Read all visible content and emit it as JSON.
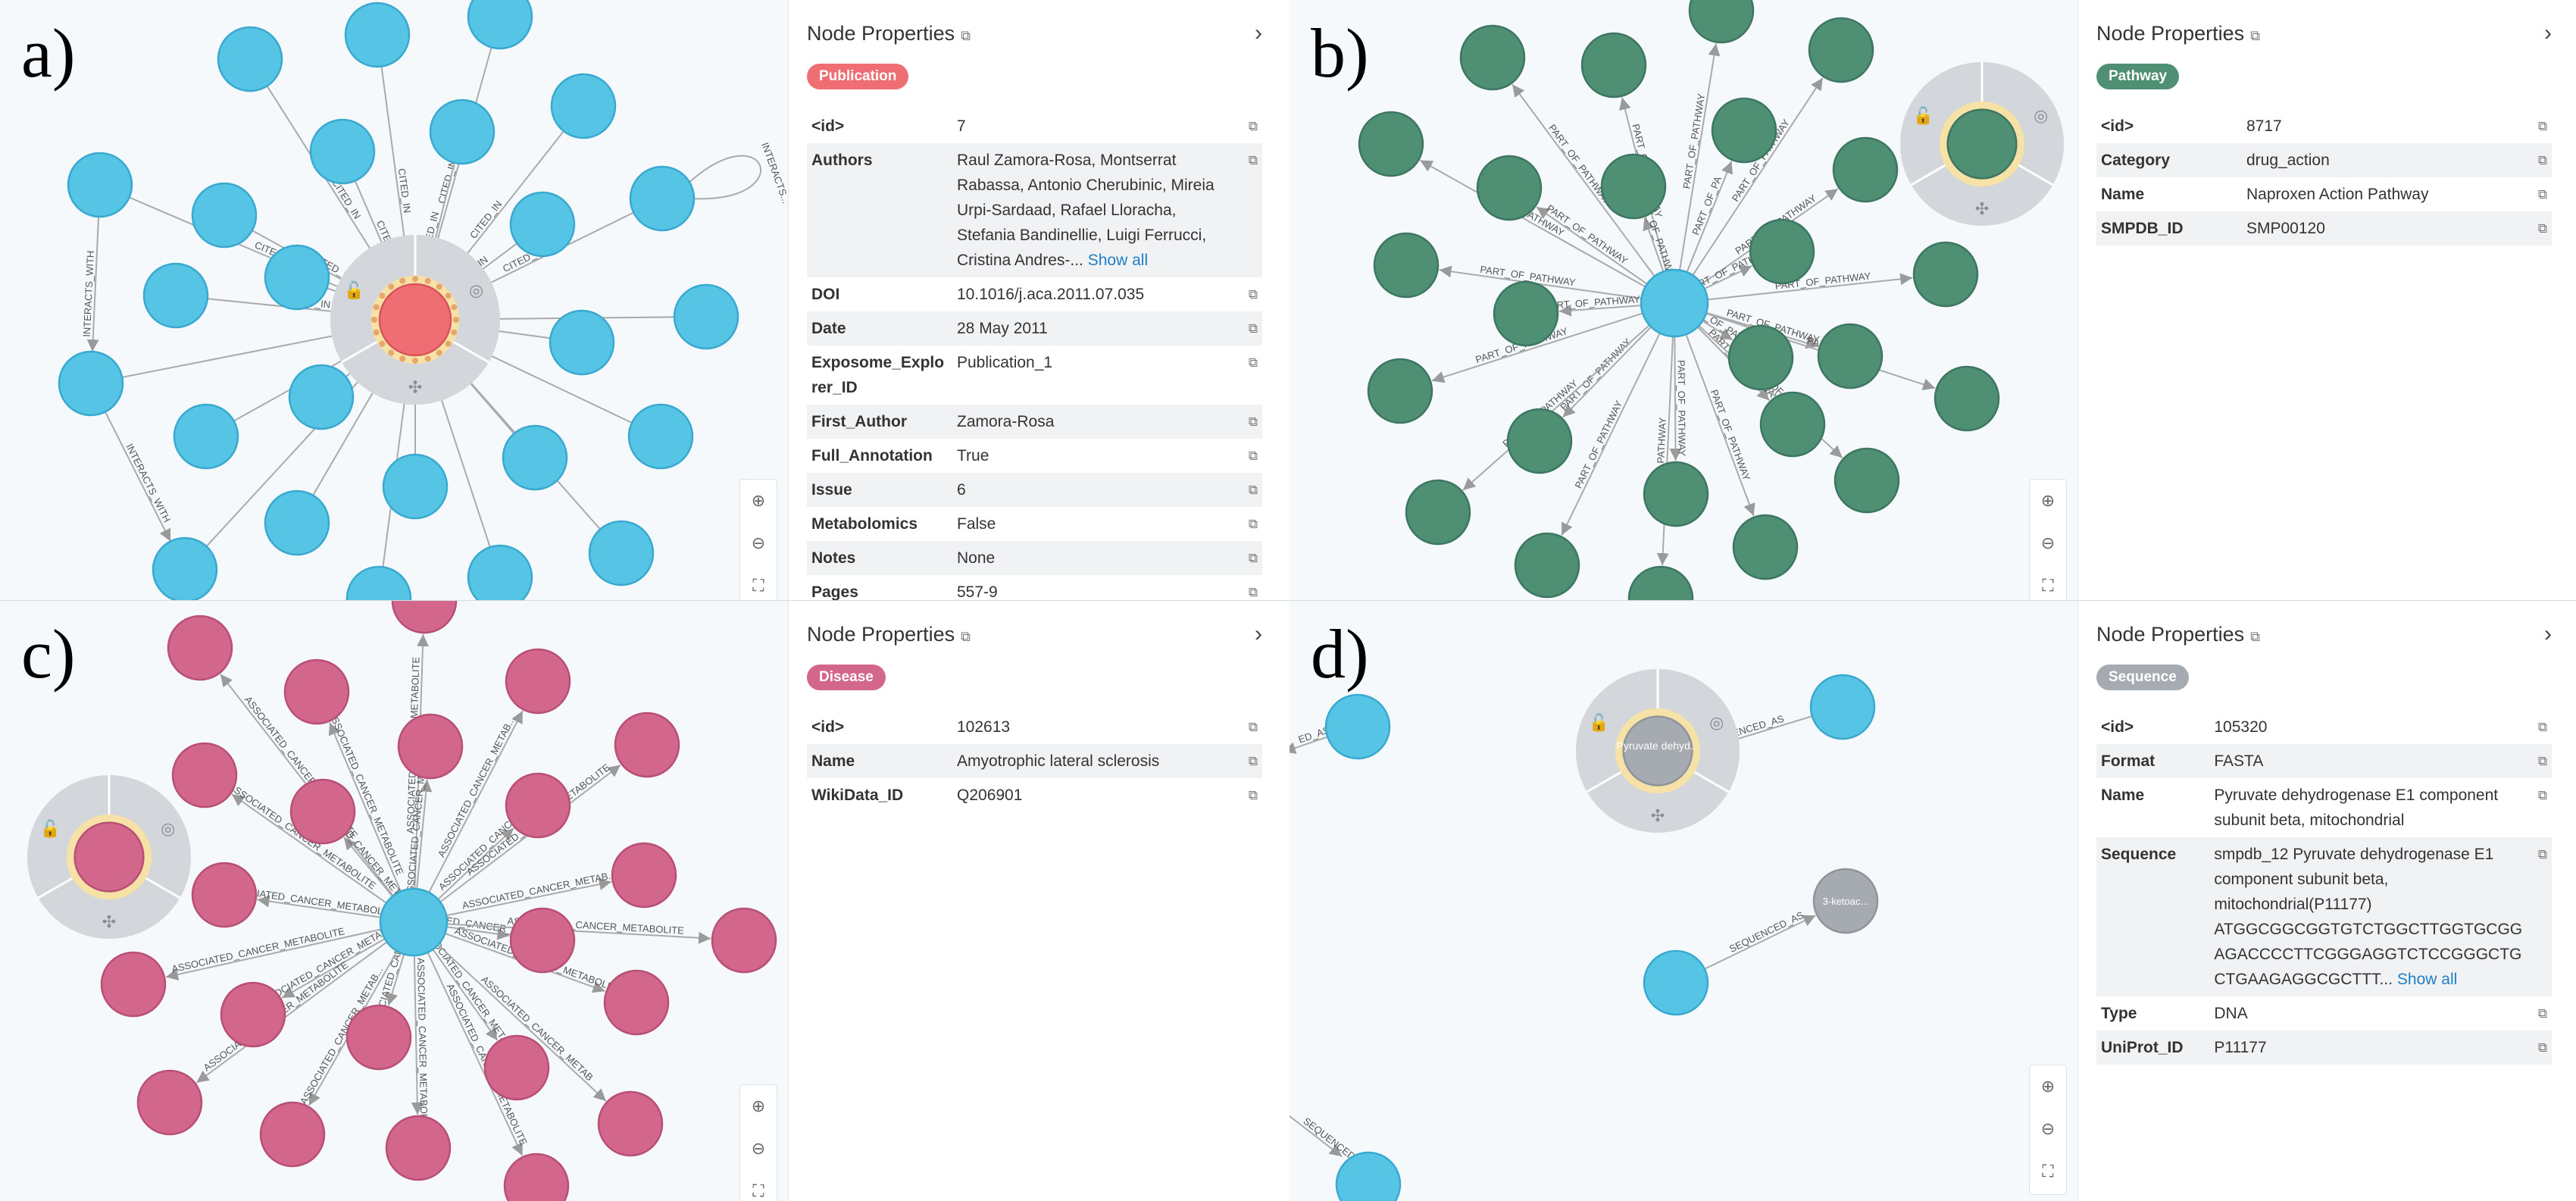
{
  "panels": {
    "a": {
      "letter": "a)",
      "title": "Node Properties",
      "badge": "Publication",
      "badge_color": "#ee6e73",
      "rows": [
        {
          "k": "<id>",
          "v": "7"
        },
        {
          "k": "Authors",
          "v": "Raul Zamora-Rosa, Montserrat Rabassa, Antonio Cherubinic, Mireia Urpi-Sardaad, Rafael Lloracha, Stefania Bandinellie, Luigi Ferrucci, Cristina Andres-...",
          "more": "Show all"
        },
        {
          "k": "DOI",
          "v": "10.1016/j.aca.2011.07.035"
        },
        {
          "k": "Date",
          "v": "28 May 2011"
        },
        {
          "k": "Exposome_Explorer_ID",
          "v": "Publication_1"
        },
        {
          "k": "First_Author",
          "v": "Zamora-Rosa"
        },
        {
          "k": "Full_Annotation",
          "v": "True"
        },
        {
          "k": "Issue",
          "v": "6"
        },
        {
          "k": "Metabolomics",
          "v": "False"
        },
        {
          "k": "Notes",
          "v": "None"
        },
        {
          "k": "Pages",
          "v": "557-9"
        }
      ],
      "edge_labels": [
        "CITED_IN",
        "CITED_IN",
        "CITED_IN",
        "CITED_IN",
        "CITED_IN",
        "CITED_IN",
        "CITED_IN",
        "CITED_IN",
        "CITED_IN",
        "INTERACTS_WITH",
        "INTERACTS_WITH",
        "INTERACTS..."
      ]
    },
    "b": {
      "letter": "b)",
      "title": "Node Properties",
      "badge": "Pathway",
      "badge_color": "#4f8f74",
      "rows": [
        {
          "k": "<id>",
          "v": "8717"
        },
        {
          "k": "Category",
          "v": "drug_action"
        },
        {
          "k": "Name",
          "v": "Naproxen Action Pathway"
        },
        {
          "k": "SMPDB_ID",
          "v": "SMP00120"
        }
      ],
      "edge_labels": [
        "PART_OF_PATHWAY",
        "PART_OF_PATHWAY",
        "PART_OF_PATHWAY",
        "PART_OF_PATHWAY",
        "PART_OF_PATHWAY",
        "PART_OF_PATHWAY",
        "PART_OF_PATHWAY",
        "PART_OF_PA",
        "PART_OF_PATHWAY",
        "PART_OF_PATHWAY"
      ]
    },
    "c": {
      "letter": "c)",
      "title": "Node Properties",
      "badge": "Disease",
      "badge_color": "#d3668b",
      "rows": [
        {
          "k": "<id>",
          "v": "102613"
        },
        {
          "k": "Name",
          "v": "Amyotrophic lateral sclerosis"
        },
        {
          "k": "WikiData_ID",
          "v": "Q206901"
        }
      ],
      "edge_labels": [
        "ASSOCIATED_CANCER_METABOLITE",
        "ASSOCIATED_CANCER_METABOLITE",
        "ASSOCIATED_CANCER_METABOLITE",
        "ASSOCIATED_CANCER_METAB...",
        "ASSOCIATED_CANCER_METABOLITE",
        "ASSOCIATED_CANCER_METABOLITE",
        "ASSOCIATED_CANCER_METAB",
        "ASSOCIATED_CANCE"
      ]
    },
    "d": {
      "letter": "d)",
      "title": "Node Properties",
      "badge": "Sequence",
      "badge_color": "#a6aab1",
      "rows": [
        {
          "k": "<id>",
          "v": "105320"
        },
        {
          "k": "Format",
          "v": "FASTA"
        },
        {
          "k": "Name",
          "v": "Pyruvate dehydrogenase E1 component subunit beta, mitochondrial"
        },
        {
          "k": "Sequence",
          "v": "smpdb_12 Pyruvate dehydrogenase E1 component subunit beta, mitochondrial(P11177) ATGGCGGCGGTGTCTGGCTTGGTGCGG AGACCCCTTCGGGAGGTCTCCGGGCTG CTGAAGAGGCGCTTT...",
          "more": "Show all"
        },
        {
          "k": "Type",
          "v": "DNA"
        },
        {
          "k": "UniProt_ID",
          "v": "P11177"
        }
      ],
      "node_labels": [
        "Pyruvate dehyd...",
        "3-ketoac..."
      ],
      "edge_labels": [
        "SEQUENCED_AS",
        "SEQUENCED_AS",
        "SEQUENCED_AS",
        "ED_AS"
      ]
    }
  },
  "colors": {
    "neighbor_blue": "#56c4e4",
    "pathway_green": "#4f8f74",
    "disease_pink": "#d3668b",
    "publication_red": "#ee6e73",
    "sequence_gray": "#a6aab1",
    "ring_gray": "#d3d6da",
    "ring_highlight": "#f6e1a6",
    "edge": "#aaaaaa"
  },
  "icons": [
    "lock-icon",
    "eye-icon",
    "expand-icon",
    "zoom-in-icon",
    "zoom-out-icon",
    "fit-icon",
    "copy-icon",
    "chevron-right-icon"
  ]
}
